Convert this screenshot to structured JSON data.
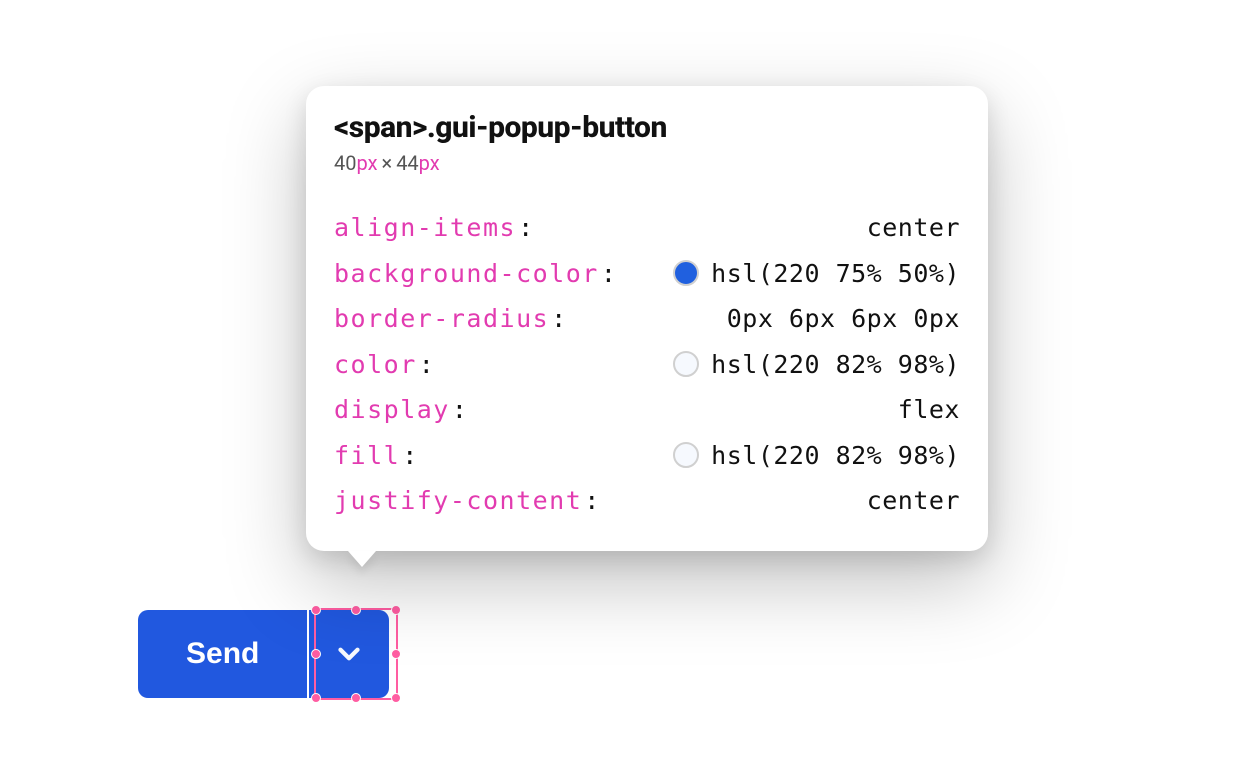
{
  "button": {
    "send_label": "Send"
  },
  "inspector": {
    "selector": "<span>.gui-popup-button",
    "dimensions": {
      "width": "40",
      "width_unit": "px",
      "sep": "×",
      "height": "44",
      "height_unit": "px"
    },
    "properties": [
      {
        "name": "align-items",
        "value": "center",
        "swatch": null
      },
      {
        "name": "background-color",
        "value": "hsl(220 75% 50%)",
        "swatch": "hsl(220 75% 50%)"
      },
      {
        "name": "border-radius",
        "value": "0px 6px 6px 0px",
        "swatch": null
      },
      {
        "name": "color",
        "value": "hsl(220 82% 98%)",
        "swatch": "hsl(220 82% 98%)"
      },
      {
        "name": "display",
        "value": "flex",
        "swatch": null
      },
      {
        "name": "fill",
        "value": "hsl(220 82% 98%)",
        "swatch": "hsl(220 82% 98%)"
      },
      {
        "name": "justify-content",
        "value": "center",
        "swatch": null
      }
    ]
  }
}
